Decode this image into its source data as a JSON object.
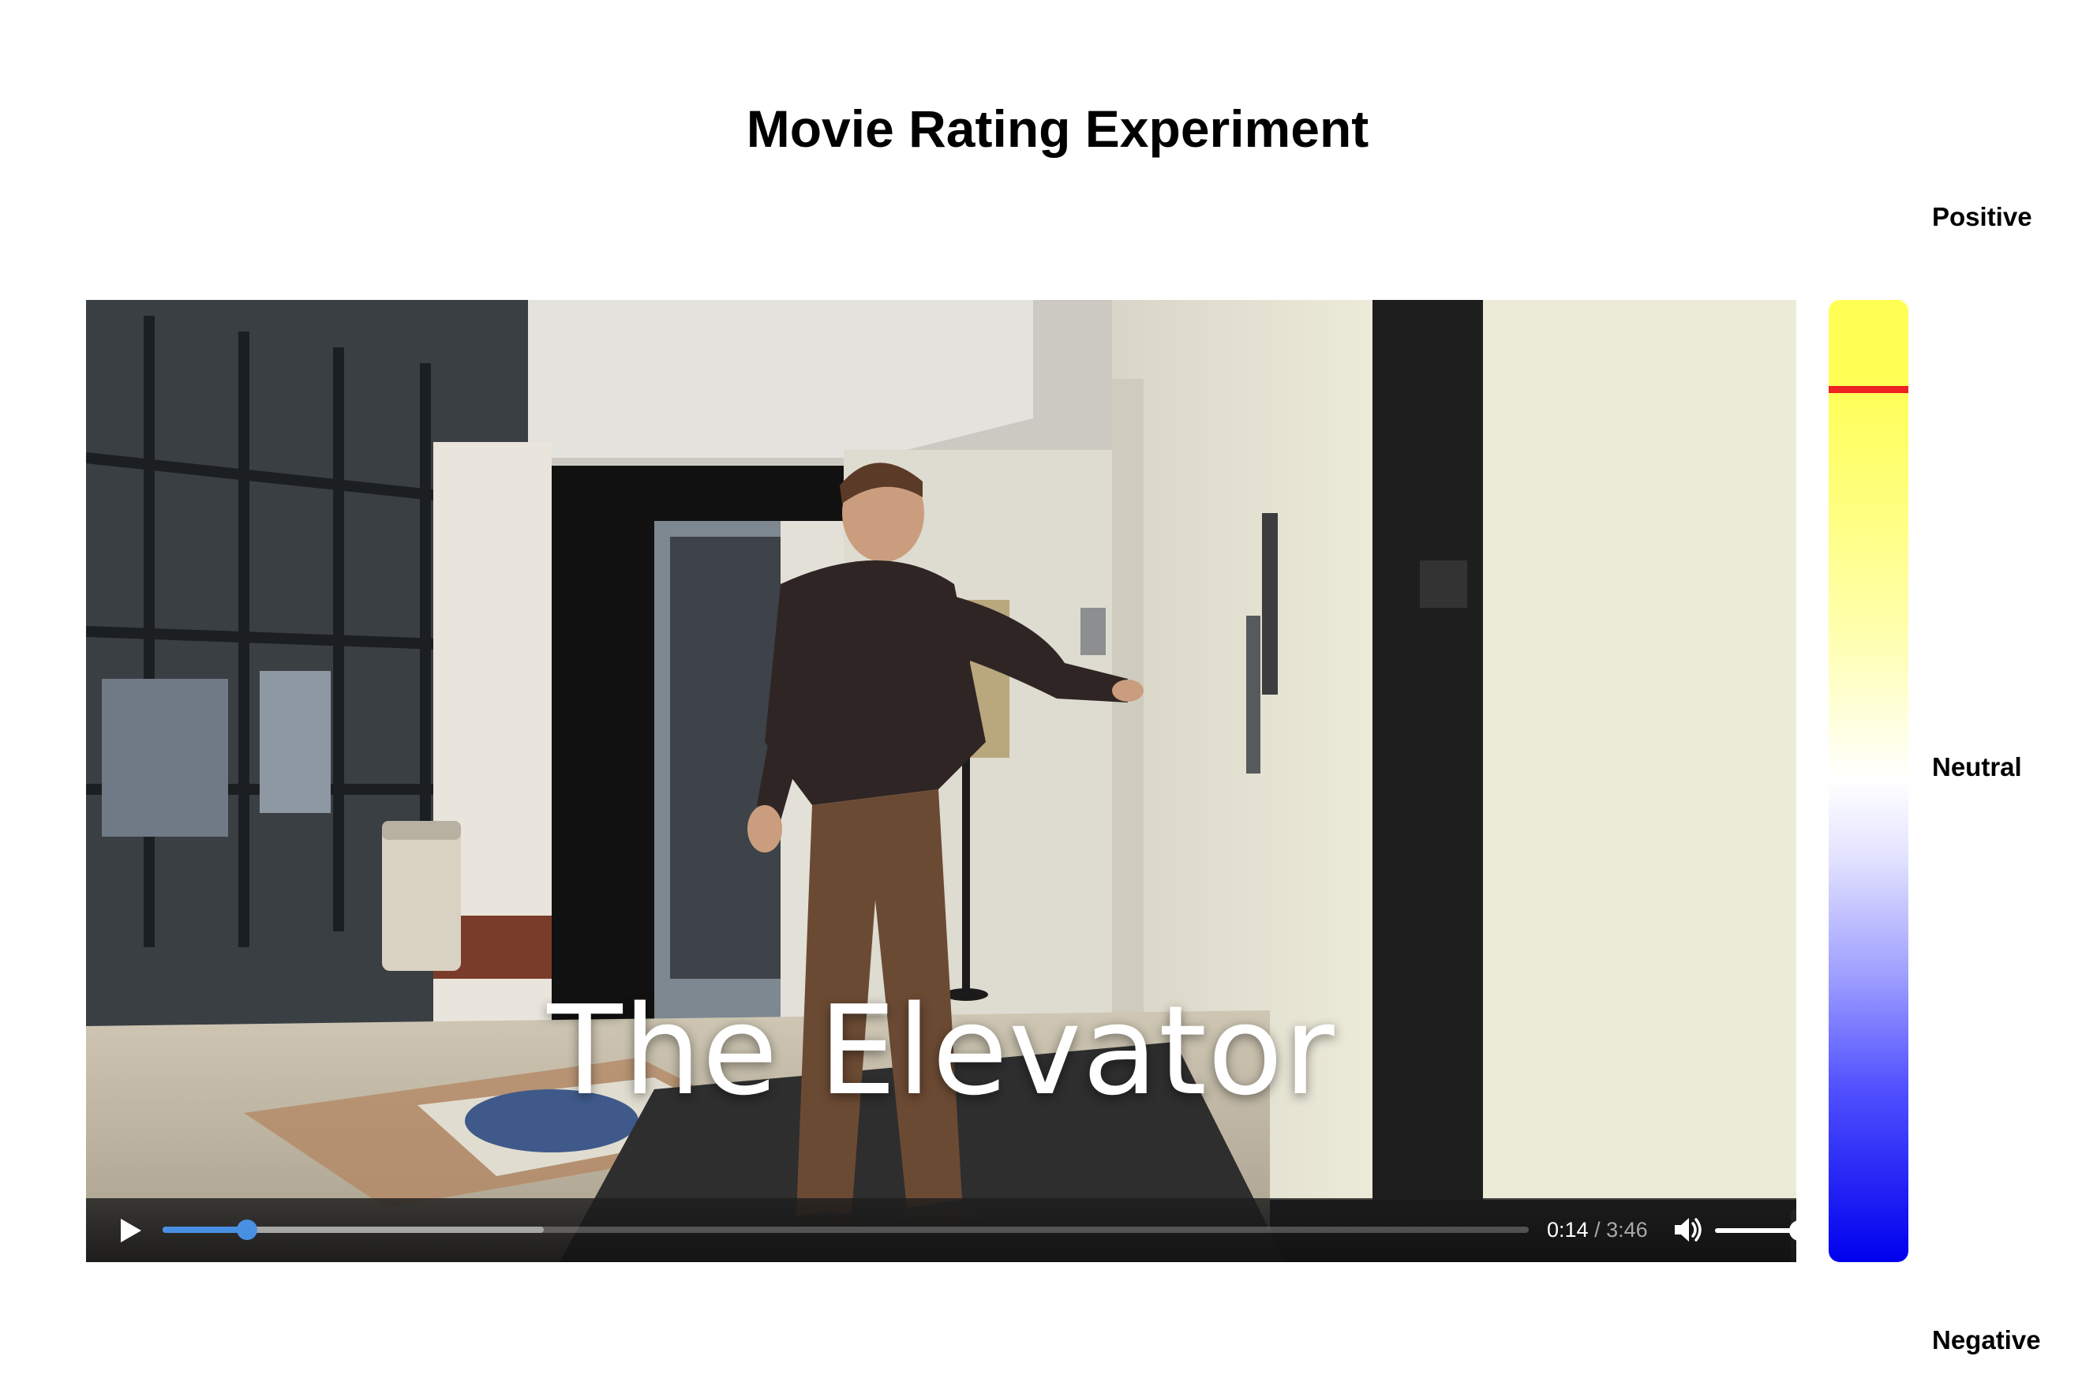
{
  "page": {
    "title": "Movie Rating Experiment"
  },
  "video": {
    "caption": "The Elevator",
    "current_time": "0:14",
    "separator": "/",
    "duration": "3:46",
    "progress_played_fraction": 0.062,
    "progress_buffered_fraction": 0.279,
    "volume_fraction": 1.0,
    "accent_color": "#4a90e2",
    "icons": {
      "play": "play-icon",
      "volume": "volume-icon",
      "fullscreen": "fullscreen-icon",
      "pip": "picture-in-picture-icon"
    }
  },
  "rating": {
    "positive_label": "Positive",
    "neutral_label": "Neutral",
    "negative_label": "Negative",
    "marker_fraction_from_top": 0.093,
    "marker_color": "#ee2222",
    "top_color": "#ffff55",
    "middle_color": "#ffffff",
    "bottom_color": "#0000ee"
  }
}
